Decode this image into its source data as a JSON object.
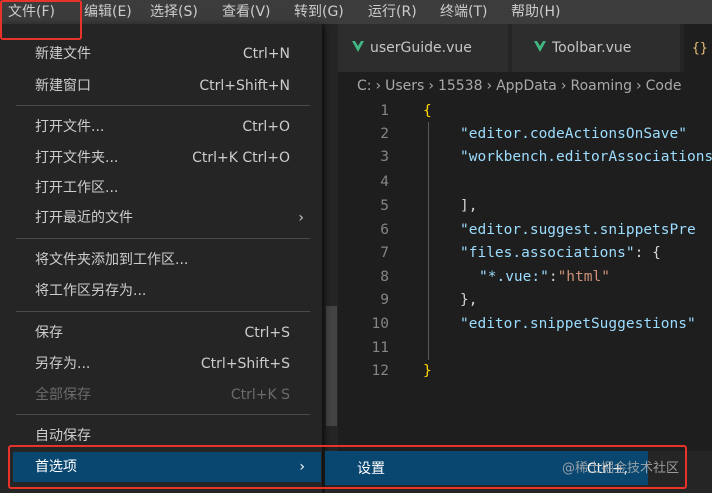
{
  "menubar": {
    "items": [
      "文件(F)",
      "编辑(E)",
      "选择(S)",
      "查看(V)",
      "转到(G)",
      "运行(R)",
      "终端(T)",
      "帮助(H)"
    ]
  },
  "tabs": [
    {
      "label": "userGuide.vue",
      "icon": "vue-icon"
    },
    {
      "label": "Toolbar.vue",
      "icon": "vue-icon"
    },
    {
      "label": "",
      "icon": "json-braces-icon"
    }
  ],
  "breadcrumb": [
    "C:",
    "Users",
    "15538",
    "AppData",
    "Roaming",
    "Code"
  ],
  "file_menu": {
    "items": [
      {
        "label": "新建文件",
        "shortcut": "Ctrl+N"
      },
      {
        "label": "新建窗口",
        "shortcut": "Ctrl+Shift+N"
      },
      {
        "label": "打开文件...",
        "shortcut": "Ctrl+O"
      },
      {
        "label": "打开文件夹...",
        "shortcut": "Ctrl+K Ctrl+O"
      },
      {
        "label": "打开工作区...",
        "shortcut": ""
      },
      {
        "label": "打开最近的文件",
        "shortcut": ""
      },
      {
        "label": "将文件夹添加到工作区...",
        "shortcut": ""
      },
      {
        "label": "将工作区另存为...",
        "shortcut": ""
      },
      {
        "label": "保存",
        "shortcut": "Ctrl+S"
      },
      {
        "label": "另存为...",
        "shortcut": "Ctrl+Shift+S"
      },
      {
        "label": "全部保存",
        "shortcut": "Ctrl+K S"
      },
      {
        "label": "自动保存",
        "shortcut": ""
      },
      {
        "label": "首选项",
        "shortcut": ""
      }
    ]
  },
  "submenu": {
    "label": "设置",
    "shortcut": "Ctrl+,"
  },
  "code": {
    "line_numbers": [
      "1",
      "2",
      "3",
      "4",
      "5",
      "6",
      "7",
      "8",
      "9",
      "10",
      "11",
      "12"
    ],
    "l2_key": "\"editor.codeActionsOnSave\"",
    "l3_key": "\"workbench.editorAssociations",
    "l5_text": "],",
    "l6_key": "\"editor.suggest.snippetsPre",
    "l7_key": "\"files.associations\"",
    "l7_rest": ": {",
    "l8_key": "\"*.vue:\"",
    "l8_colon": ":",
    "l8_val": "\"html\"",
    "l9_text": "},",
    "l10_key": "\"editor.snippetSuggestions\""
  },
  "watermark": "@稀土掘金技术社区",
  "colors": {
    "menu_bg": "#252526",
    "selection": "#094771",
    "highlight_border": "#e8332b",
    "vue_green": "#41b883"
  }
}
